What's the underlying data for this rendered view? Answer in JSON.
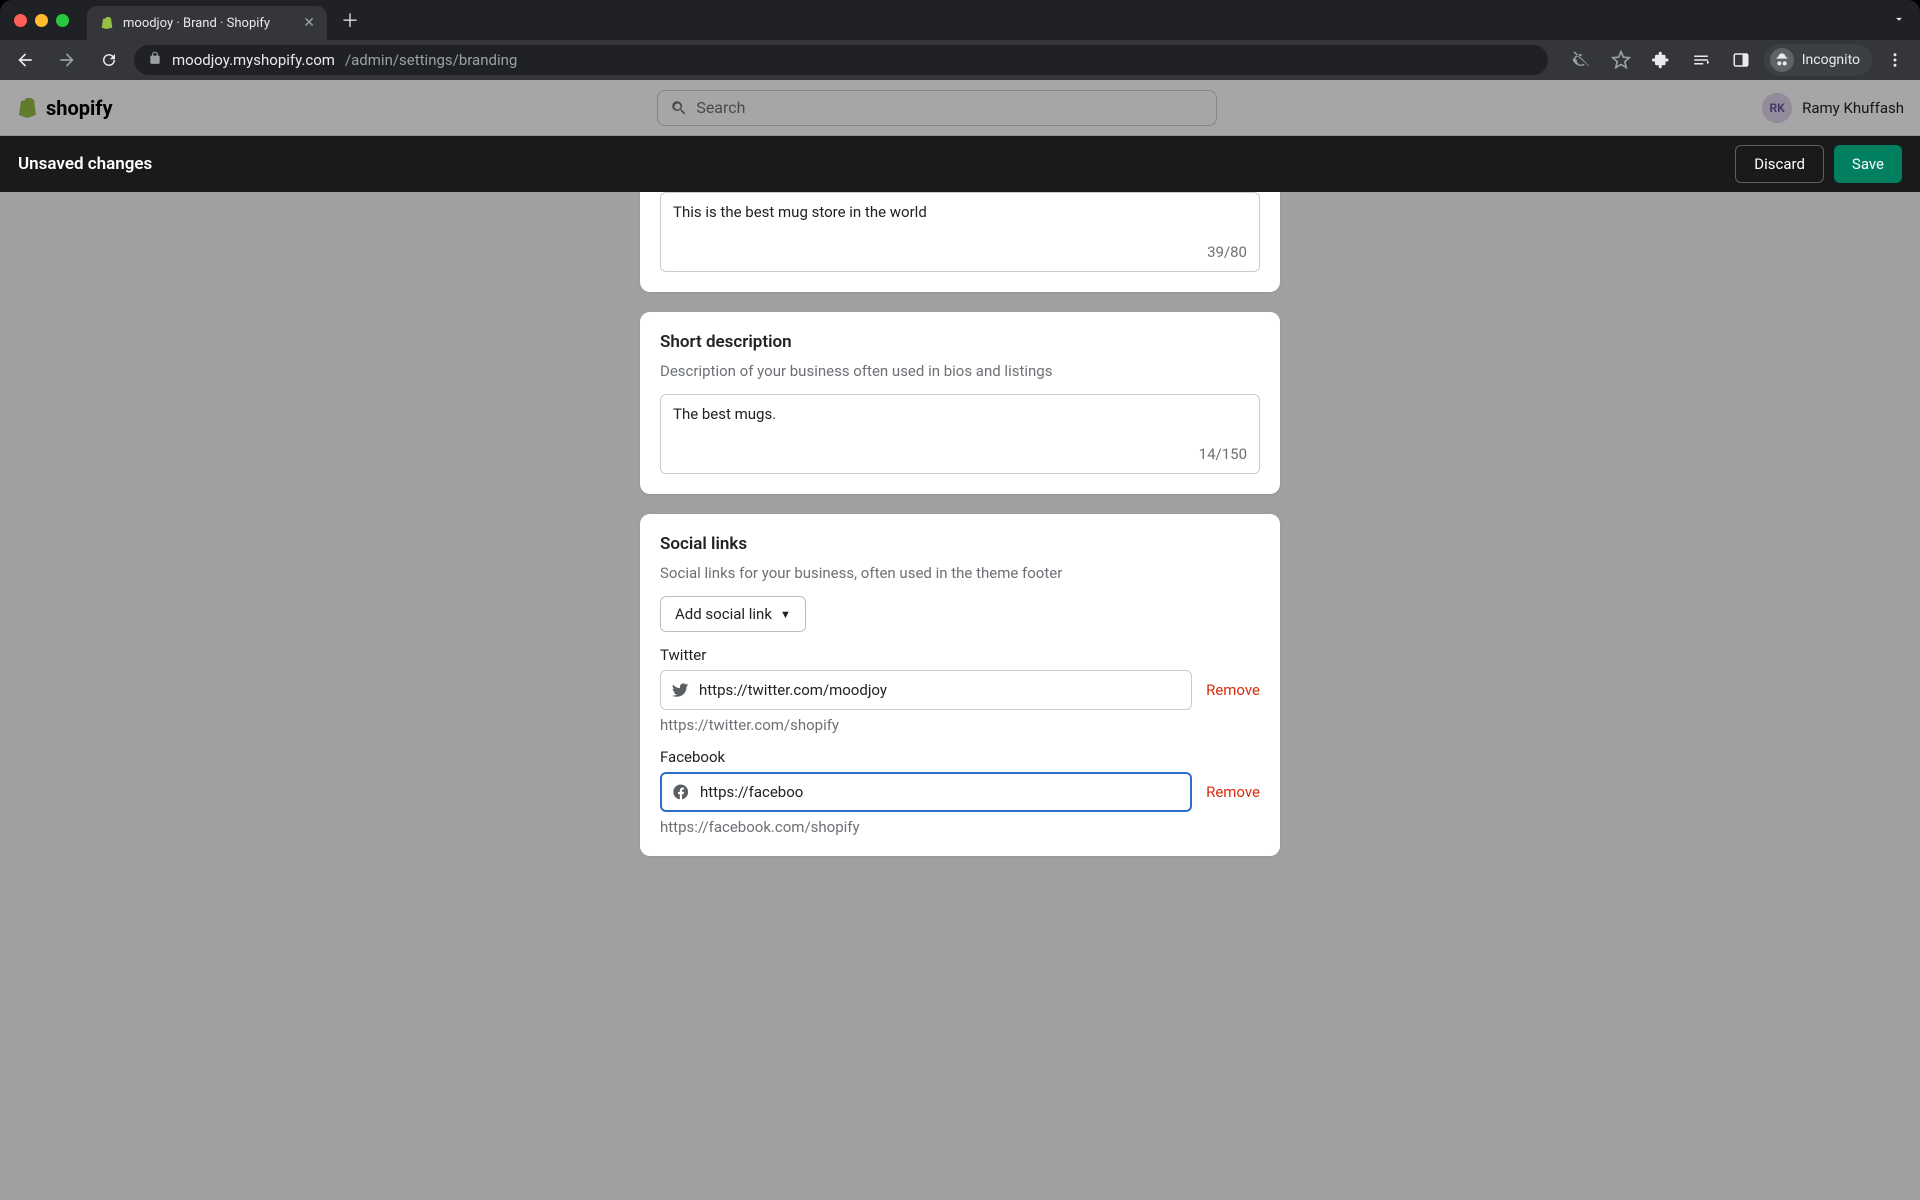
{
  "browser": {
    "tab_title": "moodjoy · Brand · Shopify",
    "url_host": "moodjoy.myshopify.com",
    "url_path": "/admin/settings/branding",
    "incognito_label": "Incognito"
  },
  "shopify_header": {
    "logo_text": "shopify",
    "search_placeholder": "Search",
    "user_initials": "RK",
    "user_name": "Ramy Khuffash"
  },
  "savebar": {
    "title": "Unsaved changes",
    "discard": "Discard",
    "save": "Save"
  },
  "slogan_card": {
    "value": "This is the best mug store in the world",
    "counter": "39/80"
  },
  "short_desc_card": {
    "title": "Short description",
    "sub": "Description of your business often used in bios and listings",
    "value": "The best mugs.",
    "counter": "14/150"
  },
  "social_card": {
    "title": "Social links",
    "sub": "Social links for your business, often used in the theme footer",
    "add_label": "Add social link",
    "twitter": {
      "label": "Twitter",
      "value": "https://twitter.com/moodjoy",
      "hint": "https://twitter.com/shopify",
      "remove": "Remove"
    },
    "facebook": {
      "label": "Facebook",
      "value": "https://faceboo",
      "hint": "https://facebook.com/shopify",
      "remove": "Remove"
    }
  }
}
